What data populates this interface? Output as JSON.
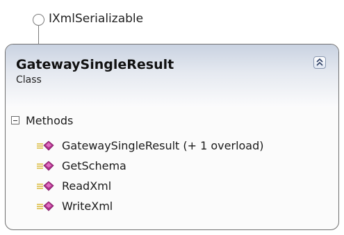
{
  "interface": {
    "name": "IXmlSerializable"
  },
  "class": {
    "name": "GatewaySingleResult",
    "stereotype": "Class",
    "compartments": [
      {
        "label": "Methods",
        "members": [
          {
            "label": "GatewaySingleResult (+ 1 overload)",
            "icon": "method-icon"
          },
          {
            "label": "GetSchema",
            "icon": "method-icon"
          },
          {
            "label": "ReadXml",
            "icon": "method-icon"
          },
          {
            "label": "WriteXml",
            "icon": "method-icon"
          }
        ]
      }
    ]
  },
  "colors": {
    "method_icon": "#b0308c",
    "method_lines": "#d9b93a",
    "header_gradient_top": "#c9d2e1"
  }
}
